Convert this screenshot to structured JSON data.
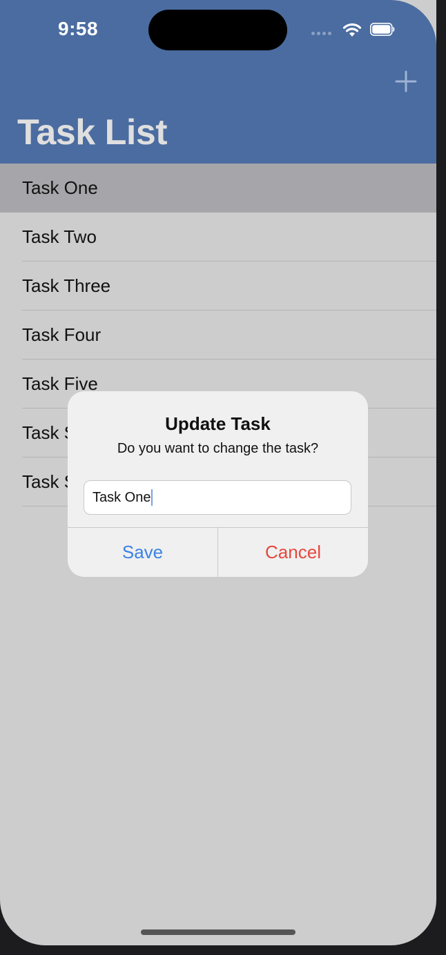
{
  "status_bar": {
    "time": "9:58",
    "icons": [
      "signal-icon",
      "wifi-icon",
      "battery-icon"
    ]
  },
  "nav": {
    "title": "Task List",
    "add_icon": "plus-icon"
  },
  "tasks": [
    {
      "label": "Task One",
      "selected": true
    },
    {
      "label": "Task Two"
    },
    {
      "label": "Task Three"
    },
    {
      "label": "Task Four"
    },
    {
      "label": "Task Five"
    },
    {
      "label": "Task S"
    },
    {
      "label": "Task S"
    }
  ],
  "alert": {
    "title": "Update Task",
    "message": "Do you want to change the task?",
    "field_value": "Task One",
    "save_label": "Save",
    "cancel_label": "Cancel"
  },
  "colors": {
    "nav_bar": "#4a6ca0",
    "save": "#3a82e4",
    "cancel": "#e5483d",
    "selected_row": "#a6a6aa"
  }
}
